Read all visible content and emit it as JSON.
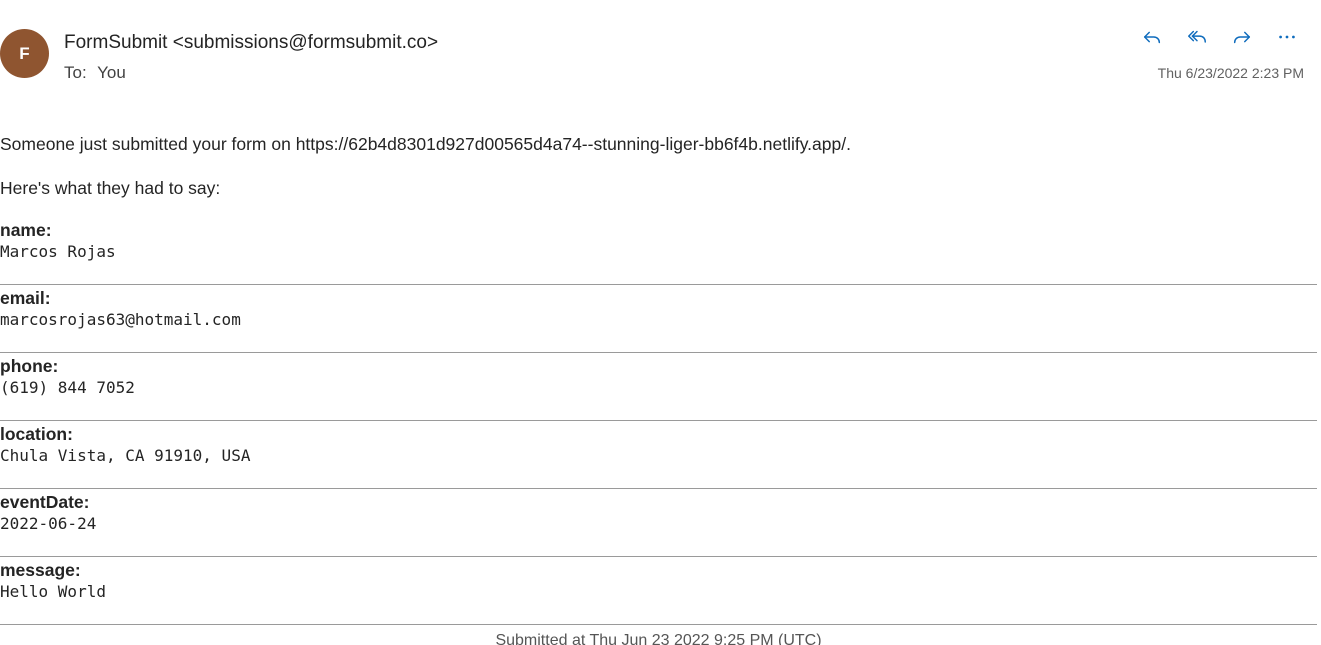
{
  "header": {
    "avatar_initial": "F",
    "avatar_color": "#8f5530",
    "sender": "FormSubmit <submissions@formsubmit.co>",
    "to_label": "To:",
    "to_value": "You",
    "date": "Thu 6/23/2022 2:23 PM",
    "actions": [
      {
        "name": "reply",
        "icon": "reply-icon"
      },
      {
        "name": "reply-all",
        "icon": "reply-all-icon"
      },
      {
        "name": "forward",
        "icon": "forward-icon"
      },
      {
        "name": "more",
        "icon": "more-icon"
      }
    ]
  },
  "body": {
    "intro": "Someone just submitted your form on https://62b4d8301d927d00565d4a74--stunning-liger-bb6f4b.netlify.app/.",
    "intro2": "Here's what they had to say:",
    "fields": [
      {
        "label": "name:",
        "value": "Marcos Rojas"
      },
      {
        "label": "email:",
        "value": "marcosrojas63@hotmail.com"
      },
      {
        "label": "phone:",
        "value": "(619) 844 7052"
      },
      {
        "label": "location:",
        "value": "Chula Vista, CA 91910, USA"
      },
      {
        "label": "eventDate:",
        "value": "2022-06-24"
      },
      {
        "label": "message:",
        "value": "Hello World"
      }
    ],
    "footer": "Submitted at Thu Jun 23 2022 9:25 PM (UTC)"
  },
  "colors": {
    "accent": "#0f6cbd",
    "divider": "#9a9a9a"
  }
}
